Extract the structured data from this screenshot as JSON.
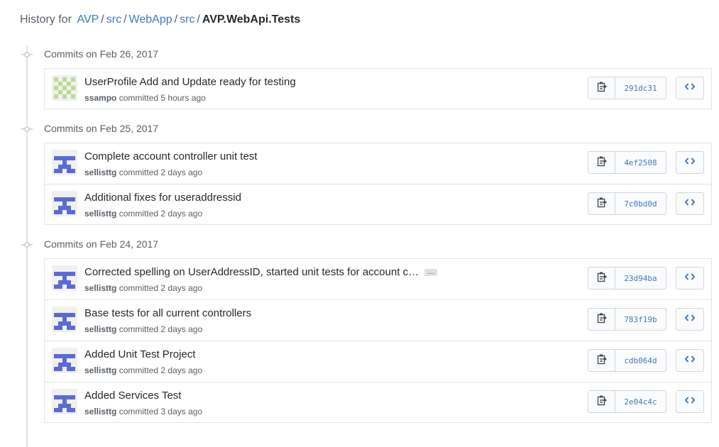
{
  "breadcrumb": {
    "prefix": "History for",
    "parts": [
      "AVP",
      "src",
      "WebApp",
      "src"
    ],
    "separator": "/",
    "current": "AVP.WebApi.Tests"
  },
  "colors": {
    "link": "#4078c0",
    "muted": "#586069",
    "border": "#e1e4e8",
    "identicon_blue": "#5b6bd6",
    "identicon_green": "#b9dc8f"
  },
  "committed_word": "committed",
  "groups": [
    {
      "title": "Commits on Feb 26, 2017",
      "commits": [
        {
          "message": "UserProfile Add and Update ready for testing",
          "author": "ssampo",
          "time": "5 hours ago",
          "sha": "291dc31",
          "avatar": "green-checker-identicon",
          "truncated": false
        }
      ]
    },
    {
      "title": "Commits on Feb 25, 2017",
      "commits": [
        {
          "message": "Complete account controller unit test",
          "author": "sellisttg",
          "time": "2 days ago",
          "sha": "4ef2508",
          "avatar": "blue-identicon",
          "truncated": false
        },
        {
          "message": "Additional fixes for useraddressid",
          "author": "sellisttg",
          "time": "2 days ago",
          "sha": "7c0bd0d",
          "avatar": "blue-identicon",
          "truncated": false
        }
      ]
    },
    {
      "title": "Commits on Feb 24, 2017",
      "commits": [
        {
          "message": "Corrected spelling on UserAddressID, started unit tests for account c…",
          "author": "sellisttg",
          "time": "2 days ago",
          "sha": "23d94ba",
          "avatar": "blue-identicon",
          "truncated": true,
          "ellipsis_label": "…"
        },
        {
          "message": "Base tests for all current controllers",
          "author": "sellisttg",
          "time": "2 days ago",
          "sha": "783f19b",
          "avatar": "blue-identicon",
          "truncated": false
        },
        {
          "message": "Added Unit Test Project",
          "author": "sellisttg",
          "time": "2 days ago",
          "sha": "cdb064d",
          "avatar": "blue-identicon",
          "truncated": false
        },
        {
          "message": "Added Services Test",
          "author": "sellisttg",
          "time": "3 days ago",
          "sha": "2e04c4c",
          "avatar": "blue-identicon",
          "truncated": false
        }
      ]
    }
  ]
}
